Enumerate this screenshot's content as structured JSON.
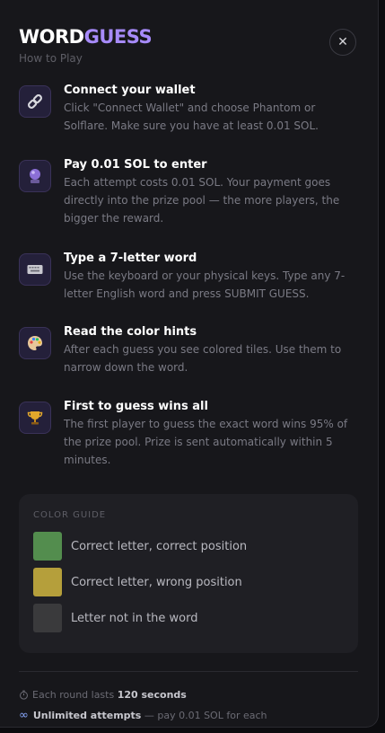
{
  "header": {
    "logo_part1": "WORD",
    "logo_part2": "GUESS",
    "subtitle": "How to Play",
    "close_label": "✕"
  },
  "steps": [
    {
      "icon": "link-icon",
      "title": "Connect your wallet",
      "desc": "Click \"Connect Wallet\" and choose Phantom or Solflare. Make sure you have at least 0.01 SOL."
    },
    {
      "icon": "crystal-ball-icon",
      "title": "Pay 0.01 SOL to enter",
      "desc": "Each attempt costs 0.01 SOL. Your payment goes directly into the prize pool — the more players, the bigger the reward."
    },
    {
      "icon": "keyboard-icon",
      "title": "Type a 7-letter word",
      "desc": "Use the keyboard or your physical keys. Type any 7-letter English word and press SUBMIT GUESS."
    },
    {
      "icon": "palette-icon",
      "title": "Read the color hints",
      "desc": "After each guess you see colored tiles. Use them to narrow down the word."
    },
    {
      "icon": "trophy-icon",
      "title": "First to guess wins all",
      "desc": "The first player to guess the exact word wins 95% of the prize pool. Prize is sent automatically within 5 minutes."
    }
  ],
  "color_guide": {
    "title": "COLOR GUIDE",
    "items": [
      {
        "color": "#538d4e",
        "label": "Correct letter, correct position"
      },
      {
        "color": "#b59f3b",
        "label": "Correct letter, wrong position"
      },
      {
        "color": "#3a3a3c",
        "label": "Letter not in the word"
      }
    ]
  },
  "footer": {
    "round_prefix": "Each round lasts",
    "round_value": "120 seconds",
    "attempts_bold": "Unlimited attempts",
    "attempts_suffix": "— pay 0.01 SOL for each"
  },
  "colors": {
    "accent": "#a78bfa",
    "background": "#17171b"
  }
}
